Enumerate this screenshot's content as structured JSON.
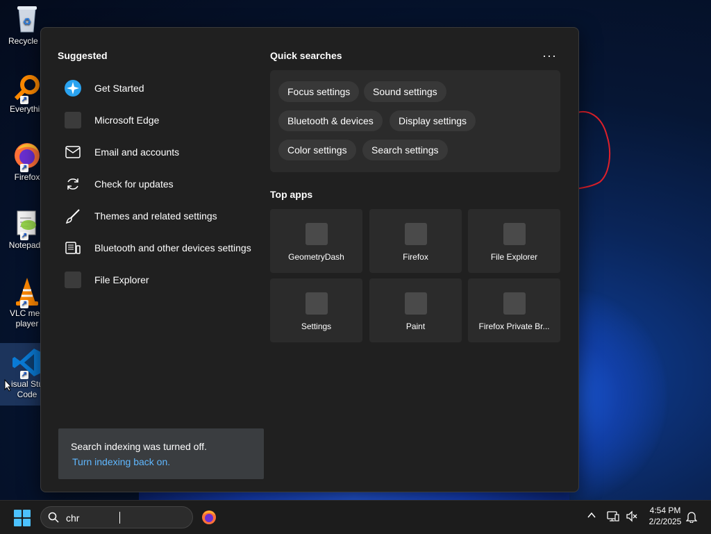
{
  "desktop": {
    "icons": [
      {
        "label": "Recycle B",
        "icon": "recycle-bin-icon"
      },
      {
        "label": "Everythin",
        "icon": "everything-search-icon"
      },
      {
        "label": "Firefox",
        "icon": "firefox-icon"
      },
      {
        "label": "Notepad+",
        "icon": "notepad-plus-plus-icon"
      },
      {
        "label": "VLC med\nplayer",
        "icon": "vlc-icon"
      },
      {
        "label": "isual Stu\nCode",
        "icon": "vscode-icon"
      }
    ]
  },
  "search_panel": {
    "suggested": {
      "title": "Suggested",
      "items": [
        {
          "label": "Get Started",
          "icon": "get-started-icon"
        },
        {
          "label": "Microsoft Edge",
          "icon": "edge-placeholder-icon"
        },
        {
          "label": "Email and accounts",
          "icon": "mail-icon"
        },
        {
          "label": "Check for updates",
          "icon": "refresh-icon"
        },
        {
          "label": "Themes and related settings",
          "icon": "brush-icon"
        },
        {
          "label": "Bluetooth and other devices settings",
          "icon": "devices-icon"
        },
        {
          "label": "File Explorer",
          "icon": "file-explorer-placeholder-icon"
        }
      ]
    },
    "quick_searches": {
      "title": "Quick searches",
      "more": "···",
      "chips": [
        "Focus settings",
        "Sound settings",
        "Bluetooth & devices",
        "Display settings",
        "Color settings",
        "Search settings"
      ]
    },
    "top_apps": {
      "title": "Top apps",
      "apps": [
        "GeometryDash",
        "Firefox",
        "File Explorer",
        "Settings",
        "Paint",
        "Firefox Private Br..."
      ]
    },
    "indexing": {
      "message": "Search indexing was turned off.",
      "link": "Turn indexing back on."
    }
  },
  "taskbar": {
    "search_value": "chr",
    "time": "4:54 PM",
    "date": "2/2/2025"
  },
  "colors": {
    "accent": "#4cc2ff",
    "link": "#60b8ff",
    "panel": "#202020"
  }
}
